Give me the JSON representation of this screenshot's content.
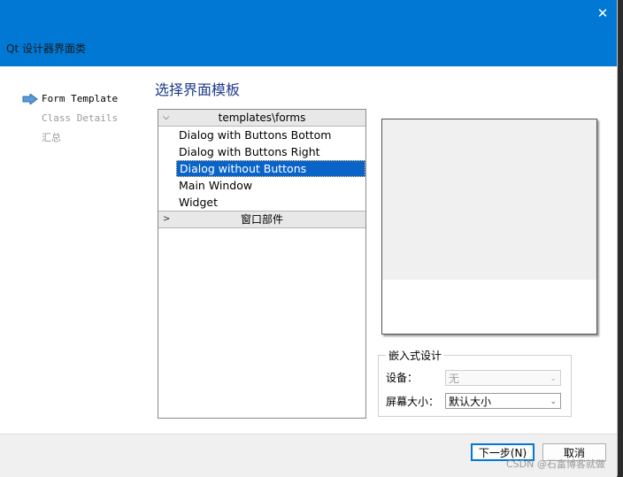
{
  "window": {
    "title": "Qt 设计器界面类",
    "close_glyph": "✕"
  },
  "steps": [
    {
      "label": "Form Template",
      "active": true
    },
    {
      "label": "Class Details",
      "active": false
    },
    {
      "label": "汇总",
      "active": false
    }
  ],
  "heading": "选择界面模板",
  "tree": {
    "category1": {
      "label": "templates\\forms",
      "expanded": true
    },
    "items": [
      "Dialog with Buttons Bottom",
      "Dialog with Buttons Right",
      "Dialog without Buttons",
      "Main Window",
      "Widget"
    ],
    "selected_index": 2,
    "category2": {
      "label": "窗口部件",
      "expanded": false
    }
  },
  "embedded": {
    "title": "嵌入式设计",
    "device_label": "设备：",
    "device_value": "无",
    "screen_label": "屏幕大小：",
    "screen_value": "默认大小"
  },
  "buttons": {
    "next": "下一步(N)",
    "cancel": "取消"
  },
  "watermark": "CSDN @石富博客就做",
  "colors": {
    "titlebar": "#0078d4",
    "selection": "#0a64c8",
    "heading": "#1f3b8a"
  }
}
